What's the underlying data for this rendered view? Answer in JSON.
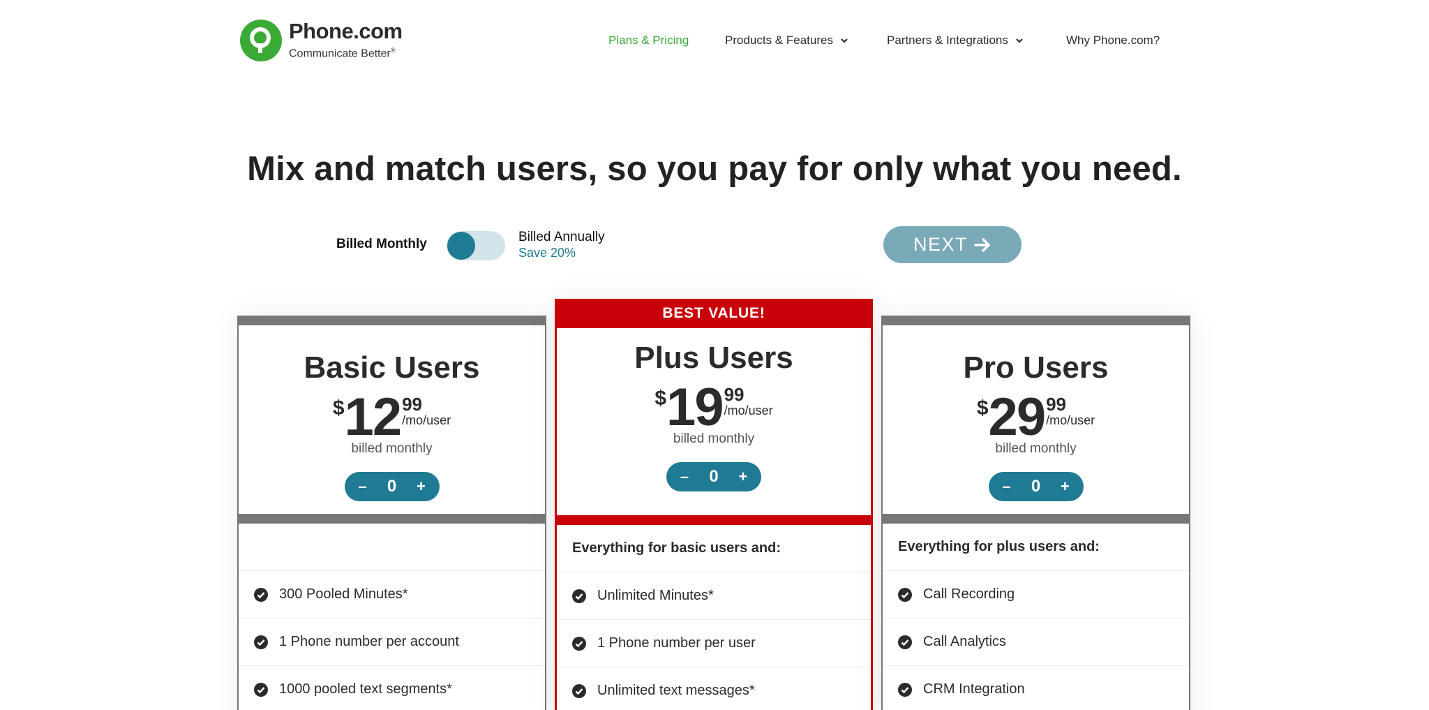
{
  "brand": {
    "name": "Phone.com",
    "tagline": "Communicate Better",
    "reg": "®",
    "color": "#3aa935"
  },
  "nav": {
    "items": [
      {
        "label": "Plans & Pricing",
        "active": true,
        "dropdown": false
      },
      {
        "label": "Products & Features",
        "active": false,
        "dropdown": true
      },
      {
        "label": "Partners & Integrations",
        "active": false,
        "dropdown": true
      },
      {
        "label": "Why Phone.com?",
        "active": false,
        "dropdown": false
      }
    ]
  },
  "headline": "Mix and match users, so you pay for only what you need.",
  "billing": {
    "monthly_label": "Billed Monthly",
    "annual_label": "Billed Annually",
    "savings": "Save 20%",
    "selected": "monthly"
  },
  "next_button": {
    "label": "NEXT",
    "icon": "arrow-right-icon"
  },
  "colors": {
    "accent": "#1f7a93",
    "featured": "#c90009",
    "card_border": "#777777",
    "next_bg": "#7aa9b8"
  },
  "plans": [
    {
      "name": "Basic Users",
      "currency": "$",
      "dollars": "12",
      "cents": "99",
      "unit": "/mo/user",
      "billed": "billed monthly",
      "quantity": "0",
      "minus": "–",
      "plus": "+",
      "features_heading": "",
      "features": [
        "300 Pooled Minutes*",
        "1 Phone number per account",
        "1000 pooled text segments*"
      ]
    },
    {
      "badge": "BEST VALUE!",
      "name": "Plus Users",
      "currency": "$",
      "dollars": "19",
      "cents": "99",
      "unit": "/mo/user",
      "billed": "billed monthly",
      "quantity": "0",
      "minus": "–",
      "plus": "+",
      "features_heading": "Everything for basic users and:",
      "features": [
        "Unlimited Minutes*",
        "1 Phone number per user",
        "Unlimited text messages*"
      ]
    },
    {
      "name": "Pro Users",
      "currency": "$",
      "dollars": "29",
      "cents": "99",
      "unit": "/mo/user",
      "billed": "billed monthly",
      "quantity": "0",
      "minus": "–",
      "plus": "+",
      "features_heading": "Everything for plus users and:",
      "features": [
        "Call Recording",
        "Call Analytics",
        "CRM Integration"
      ]
    }
  ]
}
